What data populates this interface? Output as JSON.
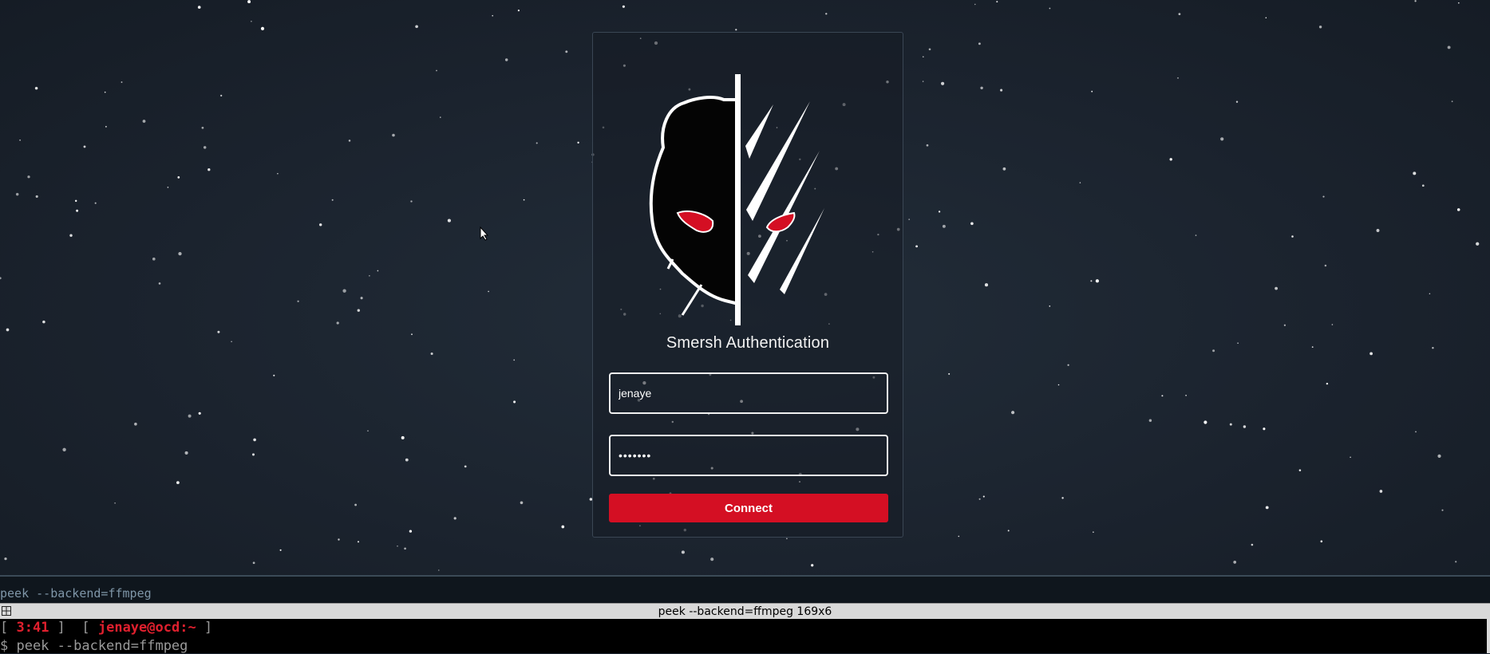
{
  "login": {
    "title": "Smersh Authentication",
    "username_value": "jenaye",
    "password_value": "•••••••",
    "connect_label": "Connect"
  },
  "colors": {
    "accent": "#d40f23",
    "background": "#1c2530",
    "terminal_prompt": "#e0202e"
  },
  "terminal": {
    "top_command": "peek --backend=ffmpeg",
    "window_title": "peek --backend=ffmpeg 169x6",
    "prompt_open": "[ ",
    "prompt_time": "3:41",
    "prompt_mid": " ]  [ ",
    "prompt_user": "jenaye@ocd:~",
    "prompt_close": " ]",
    "command_line": "$ peek --backend=ffmpeg"
  },
  "icons": {
    "logo": "smersh-mask-logo",
    "cursor": "mouse-pointer-icon",
    "window_menu": "grid-icon"
  }
}
